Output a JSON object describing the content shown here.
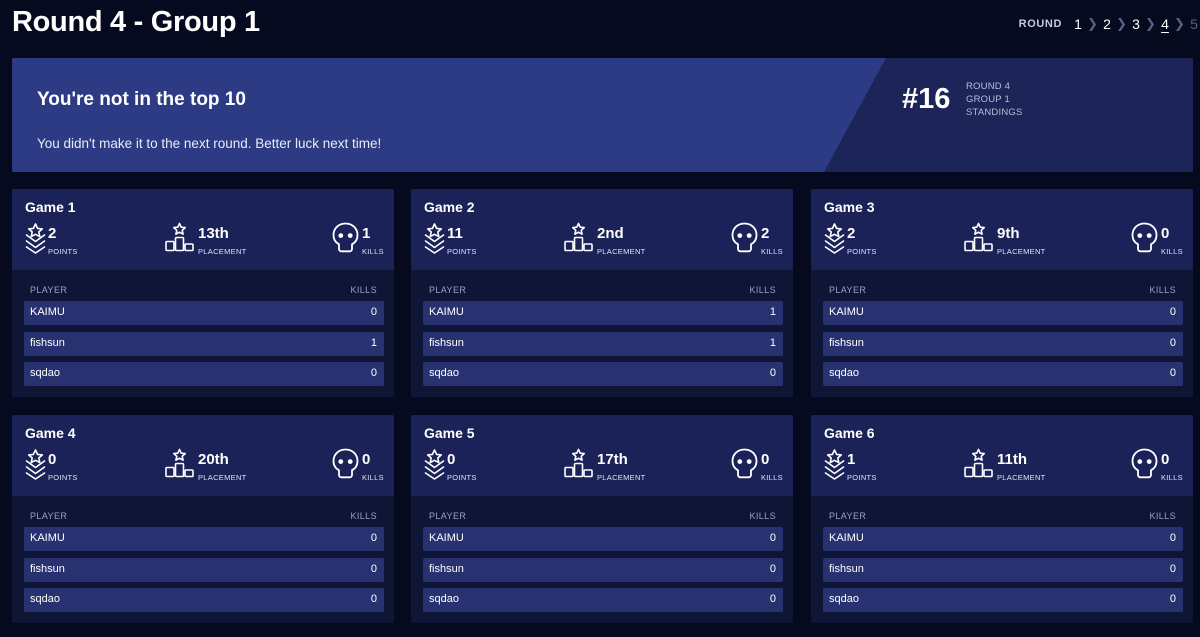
{
  "page_title": "Round 4 - Group 1",
  "round_nav": {
    "label": "ROUND",
    "rounds": [
      "1",
      "2",
      "3",
      "4",
      "5"
    ],
    "active": "4"
  },
  "banner": {
    "title": "You're not in the top 10",
    "message": "You didn't make it to the next round. Better luck next time!",
    "rank": "#16",
    "meta": [
      "ROUND 4",
      "GROUP 1",
      "STANDINGS"
    ]
  },
  "labels": {
    "points": "POINTS",
    "placement": "PLACEMENT",
    "kills": "KILLS",
    "player_col": "PLAYER",
    "kills_col": "KILLS"
  },
  "icons": {
    "points": "chevron-star-icon",
    "placement": "podium-icon",
    "kills": "skull-icon"
  },
  "colors": {
    "background": "#050a1f",
    "banner_main": "#2c3b84",
    "banner_dark": "#1c2458",
    "card_head": "#1b2257",
    "card_body": "#0f1635",
    "row": "#283270"
  },
  "games": [
    {
      "title": "Game 1",
      "points": "2",
      "placement": "13th",
      "kills": "1",
      "players": [
        {
          "name": "KAIMU",
          "kills": "0"
        },
        {
          "name": "fishsun",
          "kills": "1"
        },
        {
          "name": "sqdao",
          "kills": "0"
        }
      ]
    },
    {
      "title": "Game 2",
      "points": "11",
      "placement": "2nd",
      "kills": "2",
      "players": [
        {
          "name": "KAIMU",
          "kills": "1"
        },
        {
          "name": "fishsun",
          "kills": "1"
        },
        {
          "name": "sqdao",
          "kills": "0"
        }
      ]
    },
    {
      "title": "Game 3",
      "points": "2",
      "placement": "9th",
      "kills": "0",
      "players": [
        {
          "name": "KAIMU",
          "kills": "0"
        },
        {
          "name": "fishsun",
          "kills": "0"
        },
        {
          "name": "sqdao",
          "kills": "0"
        }
      ]
    },
    {
      "title": "Game 4",
      "points": "0",
      "placement": "20th",
      "kills": "0",
      "players": [
        {
          "name": "KAIMU",
          "kills": "0"
        },
        {
          "name": "fishsun",
          "kills": "0"
        },
        {
          "name": "sqdao",
          "kills": "0"
        }
      ]
    },
    {
      "title": "Game 5",
      "points": "0",
      "placement": "17th",
      "kills": "0",
      "players": [
        {
          "name": "KAIMU",
          "kills": "0"
        },
        {
          "name": "fishsun",
          "kills": "0"
        },
        {
          "name": "sqdao",
          "kills": "0"
        }
      ]
    },
    {
      "title": "Game 6",
      "points": "1",
      "placement": "11th",
      "kills": "0",
      "players": [
        {
          "name": "KAIMU",
          "kills": "0"
        },
        {
          "name": "fishsun",
          "kills": "0"
        },
        {
          "name": "sqdao",
          "kills": "0"
        }
      ]
    }
  ]
}
